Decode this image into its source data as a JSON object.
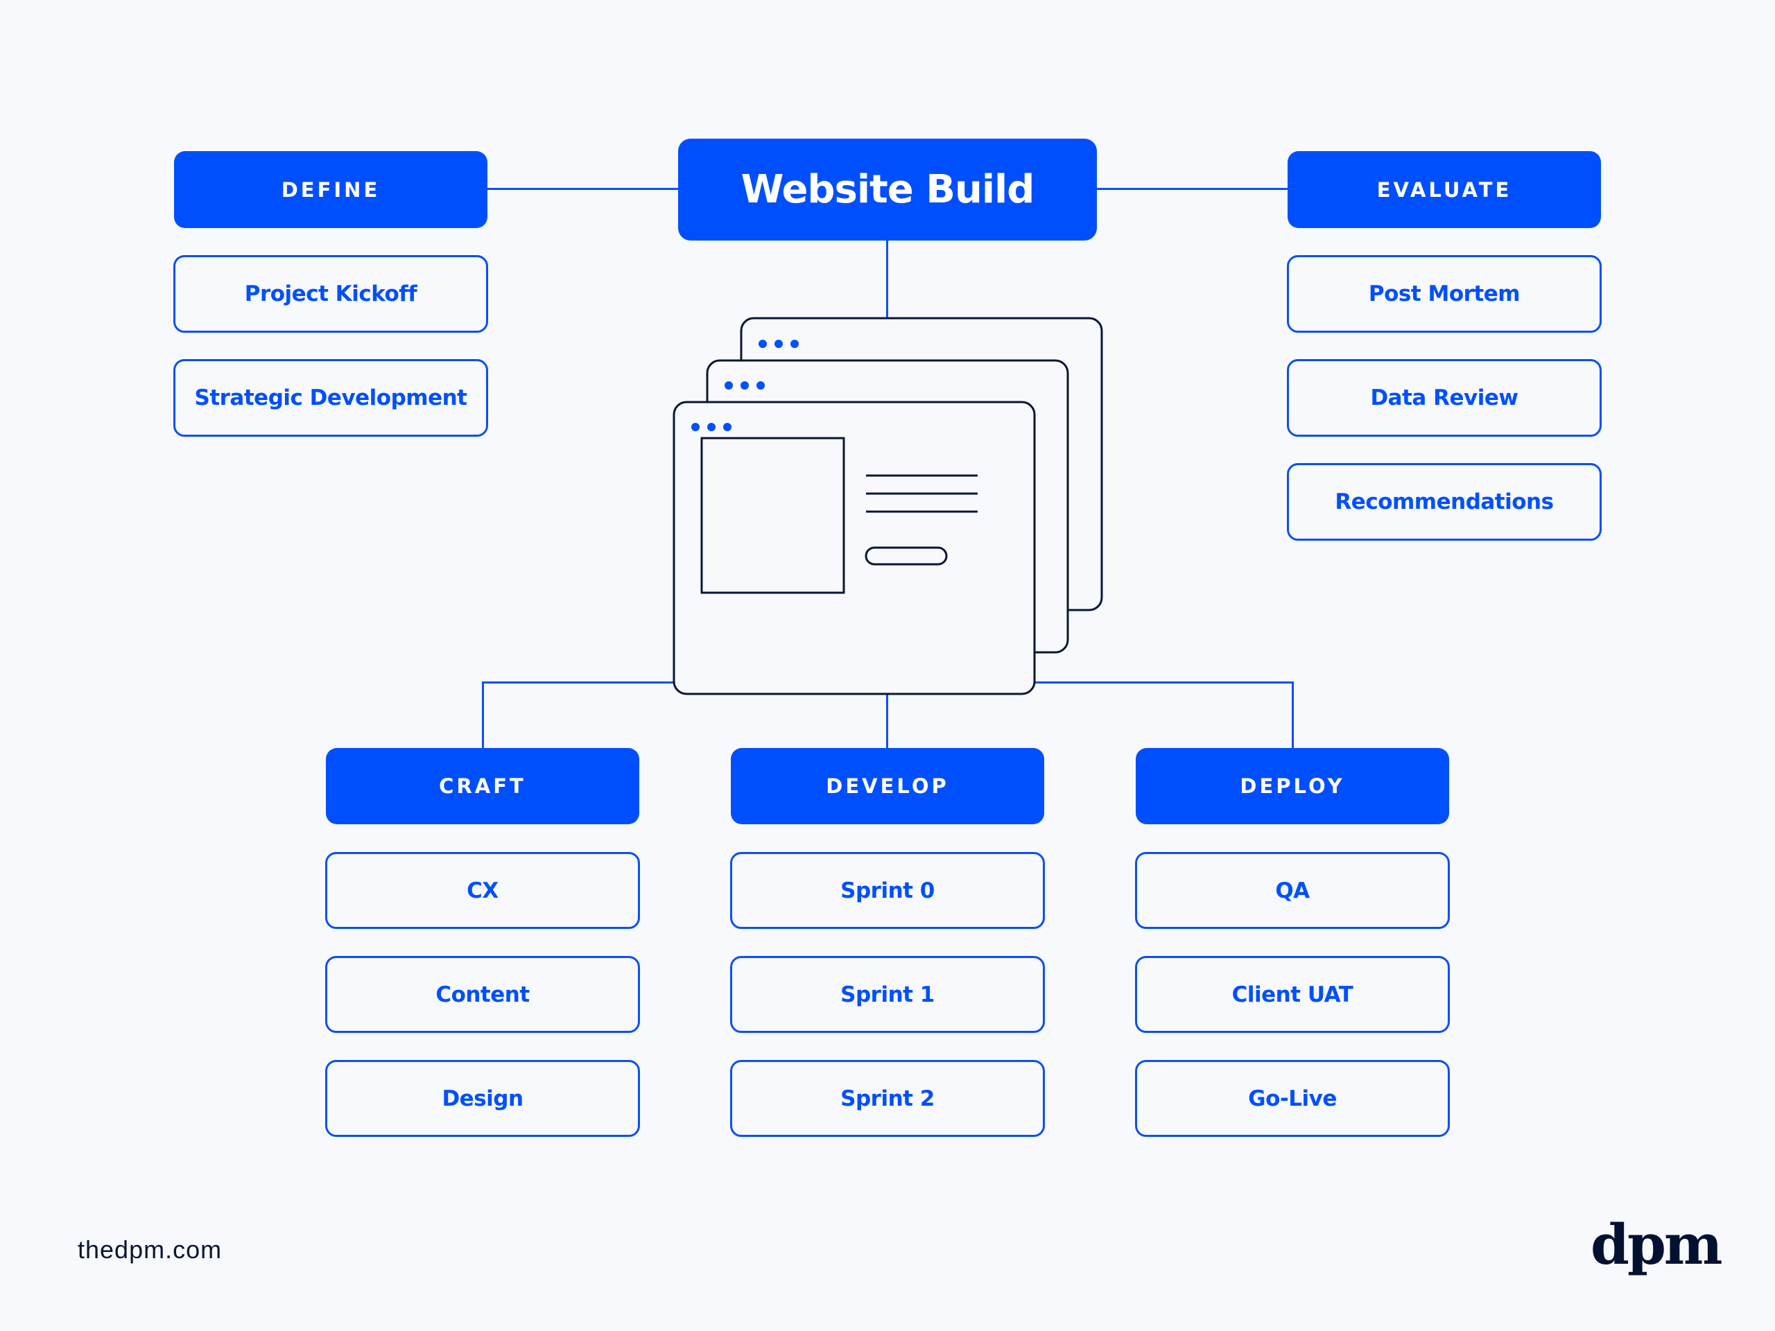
{
  "diagram": {
    "title": "Website Build",
    "phases": {
      "define": {
        "label": "DEFINE",
        "items": [
          "Project Kickoff",
          "Strategic Development"
        ]
      },
      "evaluate": {
        "label": "EVALUATE",
        "items": [
          "Post Mortem",
          "Data Review",
          "Recommendations"
        ]
      },
      "craft": {
        "label": "CRAFT",
        "items": [
          "CX",
          "Content",
          "Design"
        ]
      },
      "develop": {
        "label": "DEVELOP",
        "items": [
          "Sprint 0",
          "Sprint 1",
          "Sprint 2"
        ]
      },
      "deploy": {
        "label": "DEPLOY",
        "items": [
          "QA",
          "Client UAT",
          "Go-Live"
        ]
      }
    },
    "illustration": "stacked-browser-windows-icon"
  },
  "footer": {
    "url": "thedpm.com",
    "logo": "dpm"
  },
  "colors": {
    "accent": "#004ffe",
    "background": "#f7f9fc",
    "ink": "#021130"
  }
}
